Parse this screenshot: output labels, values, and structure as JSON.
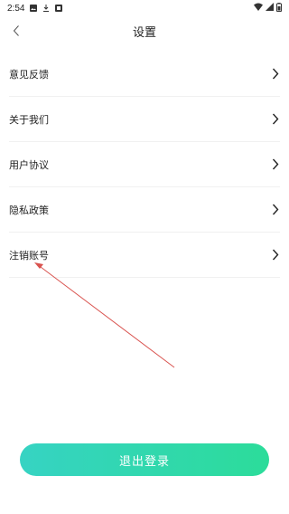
{
  "status_bar": {
    "time": "2:54",
    "left_icons": [
      "image-icon",
      "download-icon",
      "app-icon"
    ],
    "right_icons": [
      "wifi-icon",
      "cellular-signal-icon",
      "battery-icon"
    ]
  },
  "header": {
    "title": "设置",
    "back_icon": "back-chevron-icon"
  },
  "menu": {
    "items": [
      {
        "label": "意见反馈",
        "icon": "chevron-right-icon"
      },
      {
        "label": "关于我们",
        "icon": "chevron-right-icon"
      },
      {
        "label": "用户协议",
        "icon": "chevron-right-icon"
      },
      {
        "label": "隐私政策",
        "icon": "chevron-right-icon"
      },
      {
        "label": "注销账号",
        "icon": "chevron-right-icon"
      }
    ]
  },
  "logout": {
    "label": "退出登录"
  },
  "colors": {
    "accent_start": "#36d3c3",
    "accent_end": "#2cdc9a",
    "annotation_arrow": "#d9534f",
    "divider": "#f0f0f0",
    "text": "#222222"
  }
}
